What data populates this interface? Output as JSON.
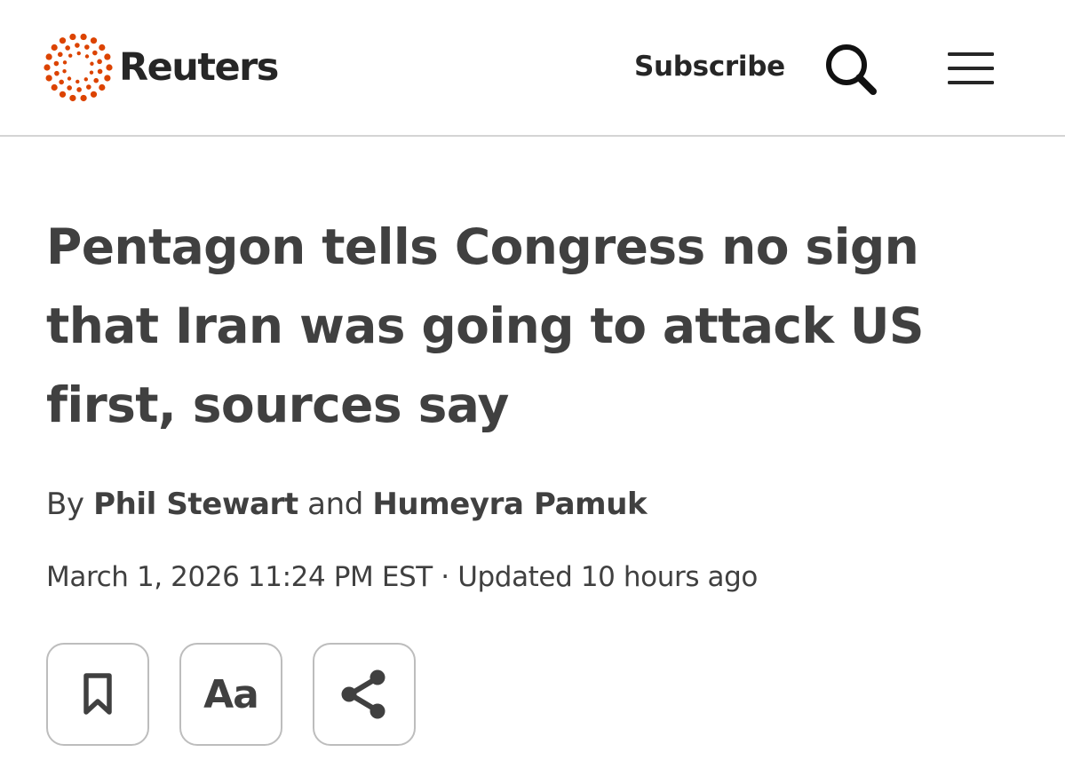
{
  "brand": {
    "name": "Reuters",
    "logo_icon": "reuters-dots-logo",
    "accent_color": "#dc4300"
  },
  "header": {
    "subscribe_label": "Subscribe",
    "search_icon": "search-icon",
    "menu_icon": "hamburger-menu-icon"
  },
  "article": {
    "headline": "Pentagon tells Congress no sign that Iran was going to attack US first, sources say",
    "byline": {
      "prefix": "By",
      "authors": [
        "Phil Stewart",
        "Humeyra Pamuk"
      ],
      "conjunction": "and"
    },
    "published": "March 1, 2026 11:24 PM EST",
    "separator": "·",
    "updated": "Updated 10 hours ago"
  },
  "actions": [
    {
      "icon": "bookmark-icon"
    },
    {
      "label": "Aa",
      "icon": "text-size-icon"
    },
    {
      "icon": "share-icon"
    }
  ],
  "colors": {
    "text": "#404040",
    "dark_text": "#262626",
    "divider": "#d4d4d4",
    "button_border": "#bdbdbd"
  }
}
